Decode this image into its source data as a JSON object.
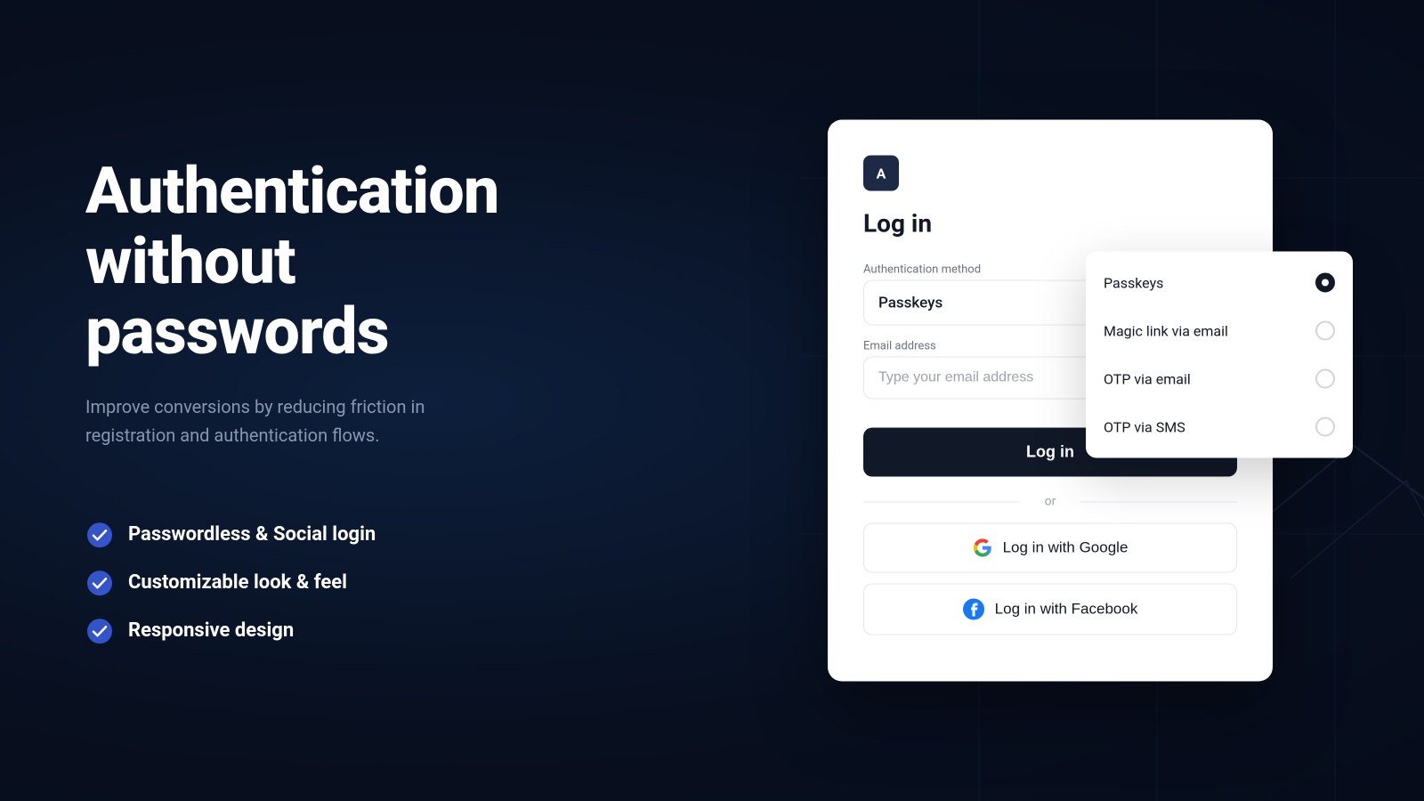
{
  "background": {
    "color": "#0a1628"
  },
  "left": {
    "heading_line1": "Authentication",
    "heading_line2": "without passwords",
    "subheading": "Improve conversions by reducing friction in registration and authentication flows.",
    "features": [
      {
        "id": "feature-1",
        "text": "Passwordless & Social login"
      },
      {
        "id": "feature-2",
        "text": "Customizable look & feel"
      },
      {
        "id": "feature-3",
        "text": "Responsive design"
      }
    ]
  },
  "card": {
    "app_letter": "A",
    "title": "Log in",
    "select_label": "Authentication method",
    "select_value": "Passkeys",
    "email_label": "Email address",
    "email_placeholder": "Type your email address",
    "login_button": "Log in",
    "or_text": "or",
    "google_button": "Log in with Google",
    "facebook_button": "Log in with Facebook"
  },
  "dropdown": {
    "items": [
      {
        "id": "passkeys",
        "label": "Passkeys",
        "selected": true
      },
      {
        "id": "magic-link",
        "label": "Magic link via email",
        "selected": false
      },
      {
        "id": "otp-email",
        "label": "OTP via email",
        "selected": false
      },
      {
        "id": "otp-sms",
        "label": "OTP via SMS",
        "selected": false
      }
    ]
  },
  "colors": {
    "accent": "#111827",
    "text_primary": "#ffffff",
    "text_muted": "#8896b0",
    "card_bg": "#ffffff",
    "border": "#e5e7eb"
  }
}
